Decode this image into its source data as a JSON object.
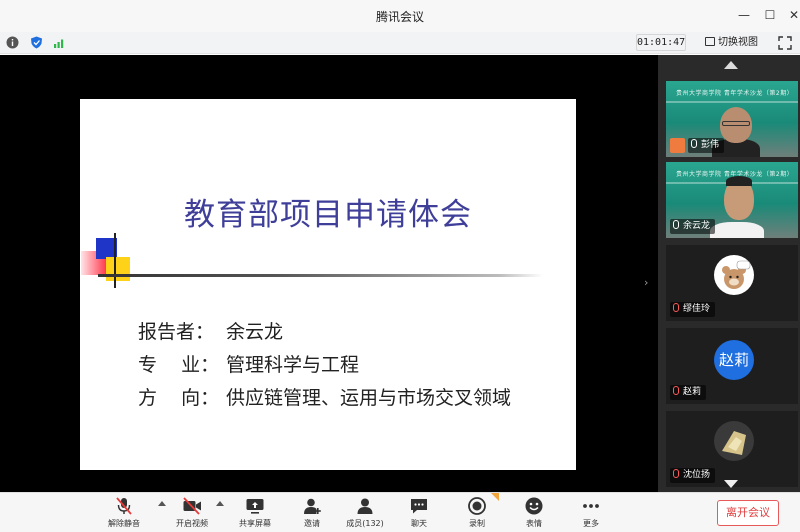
{
  "window": {
    "title": "腾讯会议",
    "controls": [
      "minimize",
      "maximize",
      "close"
    ]
  },
  "status_bar": {
    "icons": [
      "info-icon",
      "shield-icon",
      "signal-icon"
    ],
    "timer": "01:01:47",
    "switch_view_label": "切换视图"
  },
  "slide": {
    "title": "教育部项目申请体会",
    "lines": [
      {
        "label": "报告者：",
        "value": "余云龙"
      },
      {
        "label": "专    业：",
        "value": "管理科学与工程"
      },
      {
        "label": "方    向：",
        "value": "供应链管理、运用与市场交叉领域"
      }
    ]
  },
  "participants": [
    {
      "name": "彭伟",
      "type": "video",
      "host": true,
      "banner": "贵州大学商学院 青年学术沙龙（第2期）"
    },
    {
      "name": "余云龙",
      "type": "video",
      "host": false,
      "banner": "贵州大学商学院 青年学术沙龙（第2期）"
    },
    {
      "name": "缪佳玲",
      "type": "avatar",
      "host": false
    },
    {
      "name": "赵莉",
      "type": "text-avatar",
      "avatar_text": "赵莉",
      "host": false
    },
    {
      "name": "沈位扬",
      "type": "avatar",
      "host": false
    }
  ],
  "toolbar": {
    "items": [
      {
        "label": "解除静音",
        "icon": "mic-muted-icon"
      },
      {
        "label": "开启视频",
        "icon": "video-off-icon"
      },
      {
        "label": "共享屏幕",
        "icon": "share-screen-icon"
      },
      {
        "label": "邀请",
        "icon": "invite-icon"
      },
      {
        "label": "成员(132)",
        "icon": "members-icon"
      },
      {
        "label": "聊天",
        "icon": "chat-icon"
      },
      {
        "label": "录制",
        "icon": "record-icon"
      },
      {
        "label": "表情",
        "icon": "emoji-icon"
      },
      {
        "label": "更多",
        "icon": "more-icon"
      }
    ],
    "leave_label": "离开会议"
  },
  "colors": {
    "slide_title": "#3f3f9a",
    "accent_blue": "#1f6fe0",
    "leave_red": "#e03c3c",
    "muted_red": "#e83b3b",
    "tile_green": "#2aa690"
  }
}
